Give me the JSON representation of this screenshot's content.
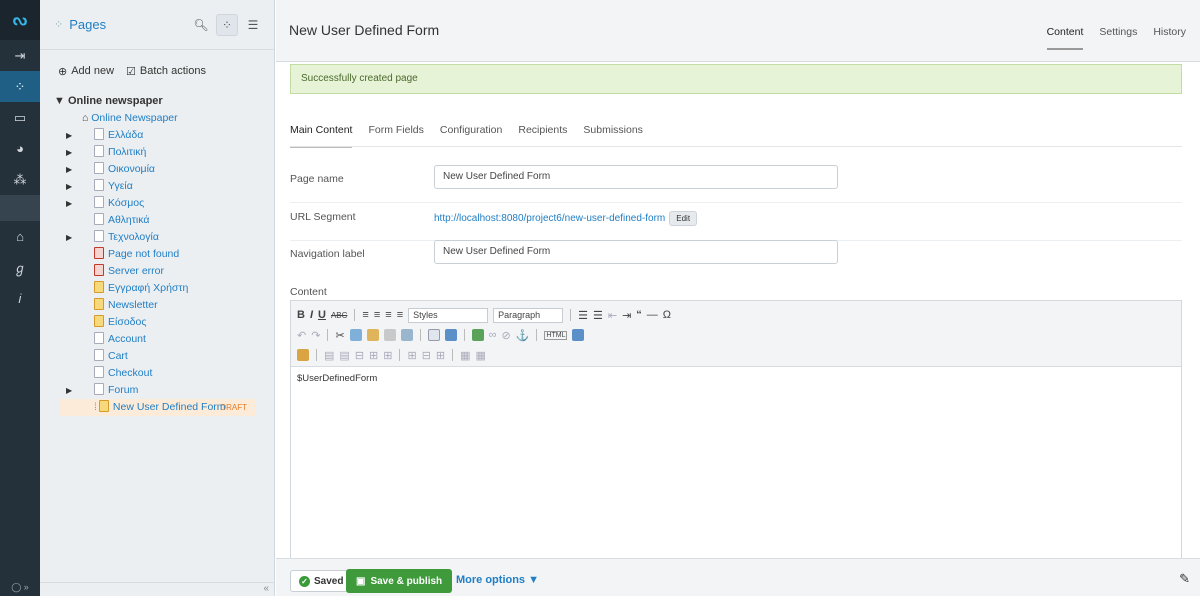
{
  "rail": {
    "logo": "ᔓ",
    "items": [
      {
        "icon": "logout-icon",
        "glyph": "⇥"
      },
      {
        "icon": "pages-icon",
        "glyph": "⁘"
      },
      {
        "icon": "files-icon",
        "glyph": "▭"
      },
      {
        "icon": "reports-icon",
        "glyph": "◕"
      },
      {
        "icon": "security-icon",
        "glyph": "⁂"
      },
      {
        "icon": "shop-icon",
        "glyph": "⌂"
      },
      {
        "icon": "settings-icon",
        "glyph": "ℊ"
      },
      {
        "icon": "help-icon",
        "glyph": "𝑖"
      }
    ],
    "footer": "◯ »"
  },
  "tree": {
    "title": "Pages",
    "add_new": "Add new",
    "batch_actions": "Batch actions",
    "root": "▼ Online newspaper",
    "home": "Online Newspaper",
    "nodes": [
      {
        "label": "Ελλάδα",
        "arrow": "▶",
        "type": "page"
      },
      {
        "label": "Πολιτική",
        "arrow": "▶",
        "type": "page"
      },
      {
        "label": "Οικονομία",
        "arrow": "▶",
        "type": "page"
      },
      {
        "label": "Υγεία",
        "arrow": "▶",
        "type": "page"
      },
      {
        "label": "Κόσμος",
        "arrow": "▶",
        "type": "page"
      },
      {
        "label": "Αθλητικά",
        "arrow": "",
        "type": "page"
      },
      {
        "label": "Τεχνολογία",
        "arrow": "▶",
        "type": "page"
      },
      {
        "label": "Page not found",
        "arrow": "",
        "type": "error"
      },
      {
        "label": "Server error",
        "arrow": "",
        "type": "error"
      },
      {
        "label": "Εγγραφή Χρήστη",
        "arrow": "",
        "type": "form"
      },
      {
        "label": "Newsletter",
        "arrow": "",
        "type": "form"
      },
      {
        "label": "Είσοδος",
        "arrow": "",
        "type": "form"
      },
      {
        "label": "Account",
        "arrow": "",
        "type": "page"
      },
      {
        "label": "Cart",
        "arrow": "",
        "type": "page"
      },
      {
        "label": "Checkout",
        "arrow": "",
        "type": "page"
      },
      {
        "label": "Forum",
        "arrow": "▶",
        "type": "page"
      }
    ],
    "current": {
      "label": "New User Defined Form",
      "badge": "DRAFT"
    },
    "collapse": "«"
  },
  "main": {
    "title": "New User Defined Form",
    "tabs": [
      "Content",
      "Settings",
      "History"
    ],
    "message": "Successfully created page",
    "subtabs": [
      "Main Content",
      "Form Fields",
      "Configuration",
      "Recipients",
      "Submissions"
    ],
    "page_name_label": "Page name",
    "page_name_value": "New User Defined Form",
    "url_label": "URL Segment",
    "url_value": "http://localhost:8080/project6/new-user-defined-form",
    "url_edit": "Edit",
    "nav_label": "Navigation label",
    "nav_value": "New User Defined Form",
    "content_label": "Content",
    "styles_select": "Styles",
    "format_select": "Paragraph",
    "editor_text": "$UserDefinedForm"
  },
  "actions": {
    "saved": "Saved",
    "publish": "Save & publish",
    "more": "More options ▼"
  },
  "colors": {
    "rail": "#24313b",
    "accent": "#1f7ec5",
    "success_bg": "#e7f3d6",
    "publish": "#3e9a3a",
    "draft": "#e07b26"
  }
}
